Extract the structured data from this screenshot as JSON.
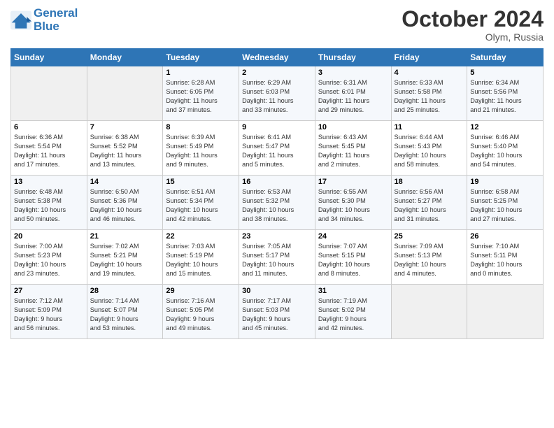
{
  "logo": {
    "line1": "General",
    "line2": "Blue"
  },
  "title": "October 2024",
  "location": "Olym, Russia",
  "days_header": [
    "Sunday",
    "Monday",
    "Tuesday",
    "Wednesday",
    "Thursday",
    "Friday",
    "Saturday"
  ],
  "weeks": [
    [
      {
        "day": "",
        "detail": ""
      },
      {
        "day": "",
        "detail": ""
      },
      {
        "day": "1",
        "detail": "Sunrise: 6:28 AM\nSunset: 6:05 PM\nDaylight: 11 hours\nand 37 minutes."
      },
      {
        "day": "2",
        "detail": "Sunrise: 6:29 AM\nSunset: 6:03 PM\nDaylight: 11 hours\nand 33 minutes."
      },
      {
        "day": "3",
        "detail": "Sunrise: 6:31 AM\nSunset: 6:01 PM\nDaylight: 11 hours\nand 29 minutes."
      },
      {
        "day": "4",
        "detail": "Sunrise: 6:33 AM\nSunset: 5:58 PM\nDaylight: 11 hours\nand 25 minutes."
      },
      {
        "day": "5",
        "detail": "Sunrise: 6:34 AM\nSunset: 5:56 PM\nDaylight: 11 hours\nand 21 minutes."
      }
    ],
    [
      {
        "day": "6",
        "detail": "Sunrise: 6:36 AM\nSunset: 5:54 PM\nDaylight: 11 hours\nand 17 minutes."
      },
      {
        "day": "7",
        "detail": "Sunrise: 6:38 AM\nSunset: 5:52 PM\nDaylight: 11 hours\nand 13 minutes."
      },
      {
        "day": "8",
        "detail": "Sunrise: 6:39 AM\nSunset: 5:49 PM\nDaylight: 11 hours\nand 9 minutes."
      },
      {
        "day": "9",
        "detail": "Sunrise: 6:41 AM\nSunset: 5:47 PM\nDaylight: 11 hours\nand 5 minutes."
      },
      {
        "day": "10",
        "detail": "Sunrise: 6:43 AM\nSunset: 5:45 PM\nDaylight: 11 hours\nand 2 minutes."
      },
      {
        "day": "11",
        "detail": "Sunrise: 6:44 AM\nSunset: 5:43 PM\nDaylight: 10 hours\nand 58 minutes."
      },
      {
        "day": "12",
        "detail": "Sunrise: 6:46 AM\nSunset: 5:40 PM\nDaylight: 10 hours\nand 54 minutes."
      }
    ],
    [
      {
        "day": "13",
        "detail": "Sunrise: 6:48 AM\nSunset: 5:38 PM\nDaylight: 10 hours\nand 50 minutes."
      },
      {
        "day": "14",
        "detail": "Sunrise: 6:50 AM\nSunset: 5:36 PM\nDaylight: 10 hours\nand 46 minutes."
      },
      {
        "day": "15",
        "detail": "Sunrise: 6:51 AM\nSunset: 5:34 PM\nDaylight: 10 hours\nand 42 minutes."
      },
      {
        "day": "16",
        "detail": "Sunrise: 6:53 AM\nSunset: 5:32 PM\nDaylight: 10 hours\nand 38 minutes."
      },
      {
        "day": "17",
        "detail": "Sunrise: 6:55 AM\nSunset: 5:30 PM\nDaylight: 10 hours\nand 34 minutes."
      },
      {
        "day": "18",
        "detail": "Sunrise: 6:56 AM\nSunset: 5:27 PM\nDaylight: 10 hours\nand 31 minutes."
      },
      {
        "day": "19",
        "detail": "Sunrise: 6:58 AM\nSunset: 5:25 PM\nDaylight: 10 hours\nand 27 minutes."
      }
    ],
    [
      {
        "day": "20",
        "detail": "Sunrise: 7:00 AM\nSunset: 5:23 PM\nDaylight: 10 hours\nand 23 minutes."
      },
      {
        "day": "21",
        "detail": "Sunrise: 7:02 AM\nSunset: 5:21 PM\nDaylight: 10 hours\nand 19 minutes."
      },
      {
        "day": "22",
        "detail": "Sunrise: 7:03 AM\nSunset: 5:19 PM\nDaylight: 10 hours\nand 15 minutes."
      },
      {
        "day": "23",
        "detail": "Sunrise: 7:05 AM\nSunset: 5:17 PM\nDaylight: 10 hours\nand 11 minutes."
      },
      {
        "day": "24",
        "detail": "Sunrise: 7:07 AM\nSunset: 5:15 PM\nDaylight: 10 hours\nand 8 minutes."
      },
      {
        "day": "25",
        "detail": "Sunrise: 7:09 AM\nSunset: 5:13 PM\nDaylight: 10 hours\nand 4 minutes."
      },
      {
        "day": "26",
        "detail": "Sunrise: 7:10 AM\nSunset: 5:11 PM\nDaylight: 10 hours\nand 0 minutes."
      }
    ],
    [
      {
        "day": "27",
        "detail": "Sunrise: 7:12 AM\nSunset: 5:09 PM\nDaylight: 9 hours\nand 56 minutes."
      },
      {
        "day": "28",
        "detail": "Sunrise: 7:14 AM\nSunset: 5:07 PM\nDaylight: 9 hours\nand 53 minutes."
      },
      {
        "day": "29",
        "detail": "Sunrise: 7:16 AM\nSunset: 5:05 PM\nDaylight: 9 hours\nand 49 minutes."
      },
      {
        "day": "30",
        "detail": "Sunrise: 7:17 AM\nSunset: 5:03 PM\nDaylight: 9 hours\nand 45 minutes."
      },
      {
        "day": "31",
        "detail": "Sunrise: 7:19 AM\nSunset: 5:02 PM\nDaylight: 9 hours\nand 42 minutes."
      },
      {
        "day": "",
        "detail": ""
      },
      {
        "day": "",
        "detail": ""
      }
    ]
  ]
}
